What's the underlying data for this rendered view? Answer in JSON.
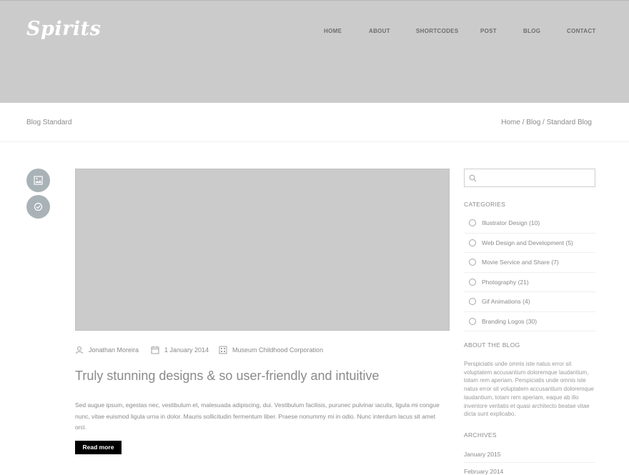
{
  "brand": {
    "logo_text": "Spirits"
  },
  "nav": {
    "items": [
      "HOME",
      "ABOUT",
      "SHORTCODES",
      "POST",
      "BLOG",
      "CONTACT"
    ]
  },
  "titlebar": {
    "page_title": "Blog Standard",
    "breadcrumb": [
      "Home",
      "Blog",
      "Standard Blog"
    ],
    "separator": "/"
  },
  "post_format_icons": [
    "image-icon",
    "check-circle-icon"
  ],
  "post": {
    "author": "Jonathan Moreira",
    "date": "1 January 2014",
    "category": "Museum Childhood Corporation",
    "title": "Truly stunning designs & so user-friendly and intuitive",
    "excerpt": "Sed augue ipsum, egestas nec, vestibulum et, malesuada adipiscing, dui. Vestibulum facilisis, purunec pulvinar iaculis, ligula mi congue nunc, vitae euismod ligula urna in dolor. Mauris sollicitudin fermentum liber. Praese nonummy mi in odio. Nunc interdum lacus sit amet orci.",
    "read_more_label": "Read more"
  },
  "sidebar": {
    "search": {
      "placeholder": "",
      "value": ""
    },
    "categories_heading": "CATEGORIES",
    "categories": [
      {
        "label": "Illustrator Design (10)"
      },
      {
        "label": "Web Design and Development (5)"
      },
      {
        "label": "Movie Service and Share (7)"
      },
      {
        "label": "Photography (21)"
      },
      {
        "label": "Gif Animations (4)"
      },
      {
        "label": "Branding Logos (30)"
      }
    ],
    "about_heading": "ABOUT THE BLOG",
    "about_text": "Perspiciatis unde omnis iste natus error sit voluptatem accusantium doloremque laudantium, totam rem aperiam. Perspiciatis unde omnis iste natus error sit voluptatem accusantium doloremque laudantium, totam rem aperiam, eaque ab illo inventore veritatis et quasi architecto beatae vitae dicta sunt explicabo.",
    "archives_heading": "ARCHIVES",
    "archives": [
      "January 2015",
      "February 2014"
    ]
  },
  "colors": {
    "hero_bg": "#cbcbcb",
    "circle_button": "#a9b2b7",
    "read_more_bg": "#000000",
    "text_gray": "#8a8a8a"
  }
}
